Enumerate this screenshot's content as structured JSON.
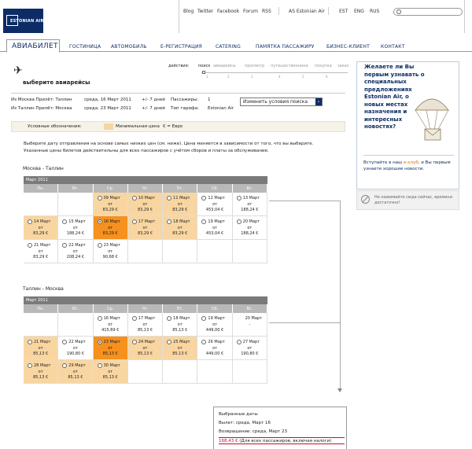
{
  "logo": {
    "text": "ESTONIAN AIR"
  },
  "top_links": [
    "Blog",
    "Twitter",
    "Facebook",
    "Forum",
    "RSS",
    "AS Estonian Air"
  ],
  "languages": [
    "EST",
    "ENG",
    "RUS"
  ],
  "nav": {
    "active_tab": "АВИАБИЛЕТ",
    "items": [
      "ГОСТИНИЦА",
      "АВТОМОБИЛЬ",
      "E-РЕГИСТРАЦИЯ",
      "CATERING",
      "ПАМЯТКА ПАССАЖИРУ",
      "БИЗНЕС-КЛИЕНТ",
      "КОНТАКТ"
    ]
  },
  "steps": {
    "label": "действия:",
    "items": [
      "поиск",
      "авиарейсы",
      "просмотр",
      "путешественники",
      "покупка",
      "заказ"
    ],
    "numbers": [
      "1",
      "2",
      "3",
      "4",
      "5",
      "6"
    ],
    "current_index": 1
  },
  "page": {
    "title": "выберите авиарейсы"
  },
  "flight_info": {
    "row1": {
      "route": "Из Москва Прилёт: Таллин",
      "date": "среда, 16 Март 2011",
      "flex": "+/- 7 дней",
      "pax_label": "Пассажиры:",
      "pax_value": "1"
    },
    "row2": {
      "route": "Из Таллин Прилёт: Москва",
      "date": "среда, 23 Март 2011",
      "flex": "+/- 7 дней",
      "fare_label": "Тип тарифа:",
      "fare_value": "Estonian Air"
    },
    "change_button": "Изменить условия поиска"
  },
  "legend": {
    "label": "Условные обозначения:",
    "min_price": "Минимальная цена",
    "euro": "€ = Евро",
    "min_color": "#f9d6a1",
    "selected_color": "#f6901e"
  },
  "intro": {
    "line1": "Выберите дату отправления на основе самых низких цен (см. ниже). Цена меняется в зависимости от того, что вы выберите.",
    "line2": "Указанные цены билетов действительны для всех пассажиров с учётом сборов и платы за обслуживание."
  },
  "weekdays": [
    "Пн.",
    "Вт.",
    "Ср.",
    "Чт.",
    "Пт.",
    "Сб.",
    "Вс."
  ],
  "outbound": {
    "route": "Москва - Таллин",
    "month": "Март 2011",
    "rows": [
      [
        {
          "type": "empty"
        },
        {
          "type": "empty"
        },
        {
          "type": "day",
          "label": "09 Март",
          "from": "от",
          "price": "83,29 €",
          "state": "low"
        },
        {
          "type": "day",
          "label": "10 Март",
          "from": "от",
          "price": "83,29 €",
          "state": "low"
        },
        {
          "type": "day",
          "label": "11 Март",
          "from": "от",
          "price": "83,29 €",
          "state": "low"
        },
        {
          "type": "day",
          "label": "12 Март",
          "from": "от",
          "price": "453,04 €",
          "state": "normal"
        },
        {
          "type": "day",
          "label": "13 Март",
          "from": "от",
          "price": "188,24 €",
          "state": "normal"
        }
      ],
      [
        {
          "type": "day",
          "label": "14 Март",
          "from": "от",
          "price": "83,29 €",
          "state": "low"
        },
        {
          "type": "day",
          "label": "15 Март",
          "from": "от",
          "price": "188,24 €",
          "state": "normal"
        },
        {
          "type": "day",
          "label": "16 Март",
          "from": "от",
          "price": "83,29 €",
          "state": "selected"
        },
        {
          "type": "day",
          "label": "17 Март",
          "from": "от",
          "price": "83,29 €",
          "state": "low"
        },
        {
          "type": "day",
          "label": "18 Март",
          "from": "от",
          "price": "83,29 €",
          "state": "low"
        },
        {
          "type": "day",
          "label": "19 Март",
          "from": "от",
          "price": "453,04 €",
          "state": "normal"
        },
        {
          "type": "day",
          "label": "20 Март",
          "from": "от",
          "price": "188,24 €",
          "state": "normal"
        }
      ],
      [
        {
          "type": "day",
          "label": "21 Март",
          "from": "от",
          "price": "83,29 €",
          "state": "normal"
        },
        {
          "type": "day",
          "label": "22 Март",
          "from": "от",
          "price": "208,24 €",
          "state": "normal"
        },
        {
          "type": "day",
          "label": "23 Март",
          "from": "от",
          "price": "90,68 €",
          "state": "normal"
        },
        {
          "type": "empty"
        },
        {
          "type": "empty"
        },
        {
          "type": "empty"
        },
        {
          "type": "empty"
        }
      ]
    ]
  },
  "inbound": {
    "route": "Таллин - Москва",
    "month": "Март 2011",
    "rows": [
      [
        {
          "type": "empty"
        },
        {
          "type": "empty"
        },
        {
          "type": "day",
          "label": "16 Март",
          "from": "от",
          "price": "415,69 €",
          "state": "normal"
        },
        {
          "type": "day",
          "label": "17 Март",
          "from": "от",
          "price": "85,13 €",
          "state": "normal"
        },
        {
          "type": "day",
          "label": "18 Март",
          "from": "от",
          "price": "85,13 €",
          "state": "normal"
        },
        {
          "type": "day",
          "label": "19 Март",
          "from": "от",
          "price": "449,00 €",
          "state": "normal"
        },
        {
          "type": "na",
          "label": "20 Март",
          "dash": "-"
        }
      ],
      [
        {
          "type": "day",
          "label": "21 Март",
          "from": "от",
          "price": "85,13 €",
          "state": "low"
        },
        {
          "type": "day",
          "label": "22 Март",
          "from": "от",
          "price": "190,80 €",
          "state": "normal"
        },
        {
          "type": "day",
          "label": "23 Март",
          "from": "от",
          "price": "85,13 €",
          "state": "selected"
        },
        {
          "type": "day",
          "label": "24 Март",
          "from": "от",
          "price": "85,13 €",
          "state": "low"
        },
        {
          "type": "day",
          "label": "25 Март",
          "from": "от",
          "price": "85,13 €",
          "state": "low"
        },
        {
          "type": "day",
          "label": "26 Март",
          "from": "от",
          "price": "449,00 €",
          "state": "normal"
        },
        {
          "type": "day",
          "label": "27 Март",
          "from": "от",
          "price": "190,80 €",
          "state": "normal"
        }
      ],
      [
        {
          "type": "day",
          "label": "28 Март",
          "from": "от",
          "price": "85,13 €",
          "state": "low"
        },
        {
          "type": "day",
          "label": "29 Март",
          "from": "от",
          "price": "85,13 €",
          "state": "low"
        },
        {
          "type": "day",
          "label": "30 Март",
          "from": "от",
          "price": "85,13 €",
          "state": "low"
        },
        {
          "type": "empty"
        },
        {
          "type": "empty"
        },
        {
          "type": "empty"
        },
        {
          "type": "empty"
        }
      ]
    ]
  },
  "summary": {
    "title": "Выбранные даты",
    "departure": "Вылет: среда, Март 16",
    "return": "Возвращение: среда, Март 23",
    "total": "168,43 €",
    "total_note": "(Для всех пассажиров, включая налоги)"
  },
  "promo": {
    "question": "Желаете ли Вы первым узнавать о специальных предложениях Estonian Air, о новых местах назначения и интересных новостях?",
    "cta_pre": "Вступайте в наш ",
    "cta_link": "e-клуб",
    "cta_post": ", и Вы первым узнаете хорошие новости.",
    "footer": "Не нажимайте сюда сейчас, времени достаточно!"
  }
}
